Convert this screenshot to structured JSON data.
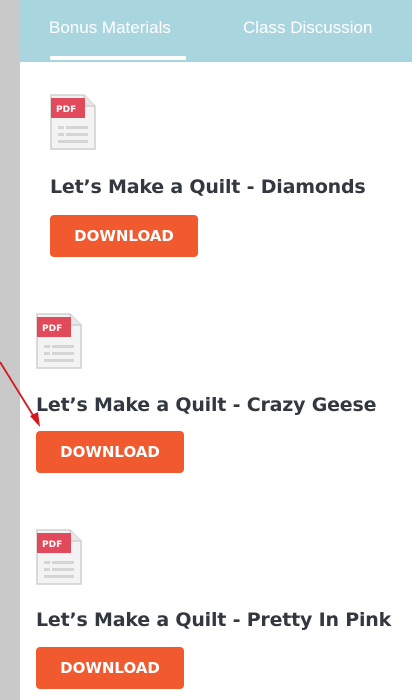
{
  "tabs": [
    {
      "label": "Bonus Materials",
      "active": true
    },
    {
      "label": "Class Discussion",
      "active": false
    }
  ],
  "items": [
    {
      "file_badge": "PDF",
      "icon": "pdf-file-icon",
      "title": "Let’s Make a Quilt - Diamonds",
      "button_label": "DOWNLOAD"
    },
    {
      "file_badge": "PDF",
      "icon": "pdf-file-icon",
      "title": "Let’s Make a Quilt - Crazy Geese",
      "button_label": "DOWNLOAD"
    },
    {
      "file_badge": "PDF",
      "icon": "pdf-file-icon",
      "title": "Let’s Make a Quilt - Pretty In Pink",
      "button_label": "DOWNLOAD"
    }
  ],
  "colors": {
    "tab_bar": "#a9d5df",
    "button": "#f05a2e",
    "pdf_badge": "#e04a5a",
    "annotation_arrow": "#d4161f"
  }
}
